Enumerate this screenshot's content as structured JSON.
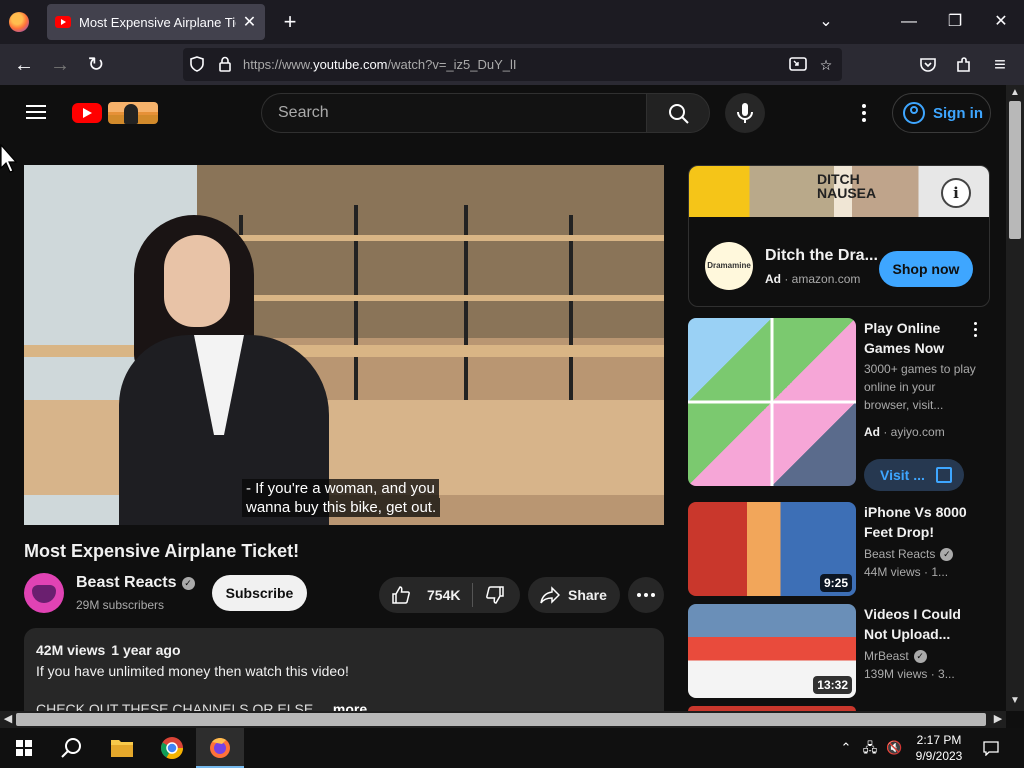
{
  "browser": {
    "tab_title": "Most Expensive Airplane Ticket!",
    "url_prefix": "https://www.",
    "url_domain": "youtube.com",
    "url_path": "/watch?v=_iz5_DuY_lI"
  },
  "header": {
    "search_placeholder": "Search",
    "sign_in": "Sign in"
  },
  "video": {
    "caption_line1": "- If you're a woman, and you",
    "caption_line2": "wanna buy this bike, get out.",
    "title": "Most Expensive Airplane Ticket!",
    "channel": "Beast Reacts",
    "subscribers": "29M subscribers",
    "subscribe_label": "Subscribe",
    "likes": "754K",
    "share_label": "Share"
  },
  "description": {
    "views": "42M views",
    "age": "1 year ago",
    "line1": "If you have unlimited money then watch this video!",
    "line2": "CHECK OUT THESE CHANNELS OR ELSE...",
    "more": "more"
  },
  "ad": {
    "banner_text_1": "DITCH",
    "banner_text_2": "NAUSEA",
    "logo_text": "Dramamine",
    "title": "Ditch the Dra...",
    "badge": "Ad",
    "domain": "amazon.com",
    "cta": "Shop now"
  },
  "recommendations": [
    {
      "title": "Play Online Games Now",
      "description": "3000+ games to play online in your browser, visit...",
      "badge": "Ad",
      "channel": "ayiyo.com",
      "cta": "Visit ..."
    },
    {
      "title": "iPhone Vs 8000 Feet Drop!",
      "channel": "Beast Reacts",
      "meta": "44M views · 1...",
      "duration": "9:25"
    },
    {
      "title": "Videos I Could Not Upload...",
      "channel": "MrBeast",
      "meta": "139M views · 3...",
      "duration": "13:32"
    }
  ],
  "taskbar": {
    "time": "2:17 PM",
    "date": "9/9/2023"
  },
  "colors": {
    "accent_blue": "#3ea6ff",
    "yt_red": "#ff0000",
    "page_bg": "#0f0f0f"
  }
}
